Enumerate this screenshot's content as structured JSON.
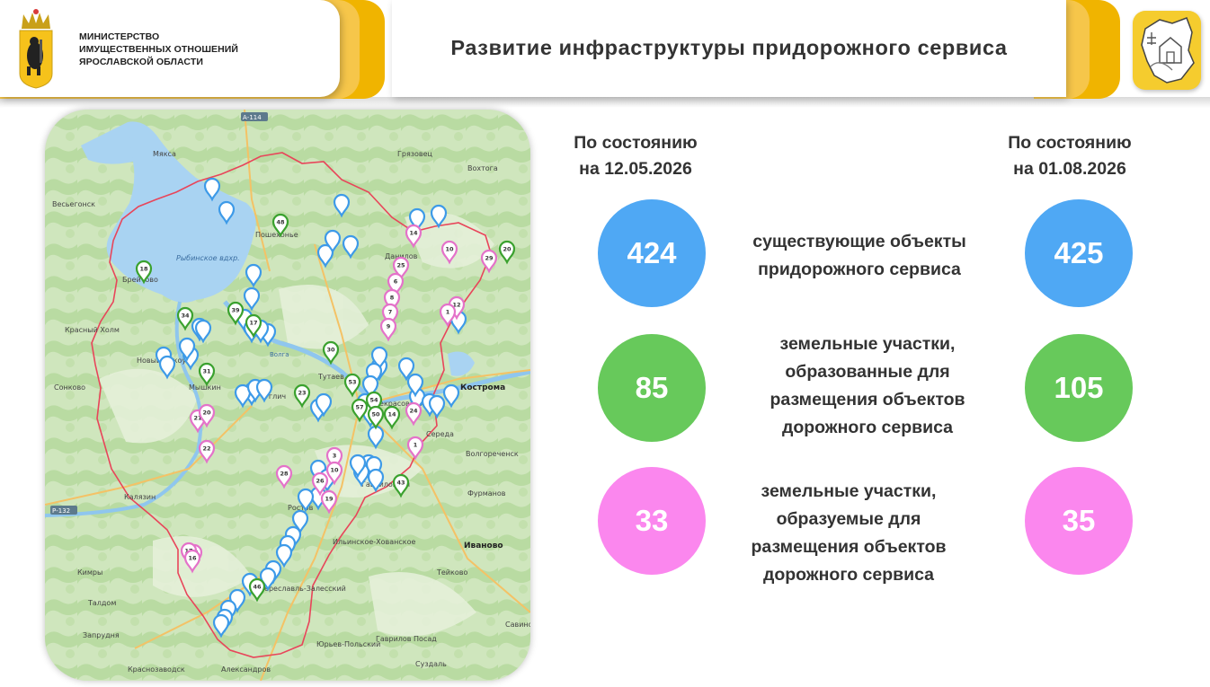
{
  "header": {
    "ministry_line1": "МИНИСТЕРСТВО",
    "ministry_line2": "ИМУЩЕСТВЕННЫХ ОТНОШЕНИЙ",
    "ministry_line3": "ЯРОСЛАВСКОЙ ОБЛАСТИ",
    "title": "Развитие инфраструктуры придорожного сервиса",
    "coat_of_arms_icon": "yaroslavl-bear-coat-icon",
    "right_logo_icon": "region-map-house-logo-icon"
  },
  "columns": {
    "left_line1": "По состоянию",
    "left_line2": "на 12.05.2026",
    "right_line1": "По состоянию",
    "right_line2": "на 01.08.2026"
  },
  "rows": [
    {
      "label_lines": [
        "существующие объекты",
        "придорожного сервиса"
      ],
      "value_before": "424",
      "value_after": "425",
      "color": "#4fa8f4"
    },
    {
      "label_lines": [
        "земельные участки,",
        "образованные для",
        "размещения объектов",
        "дорожного сервиса"
      ],
      "value_before": "85",
      "value_after": "105",
      "color": "#67c95b"
    },
    {
      "label_lines": [
        "земельные участки,",
        "образуемые для",
        "размещения объектов",
        "дорожного сервиса"
      ],
      "value_before": "33",
      "value_after": "35",
      "color": "#fb87ee"
    }
  ],
  "map": {
    "place_labels": [
      "Мякса",
      "Грязовец",
      "Вохтога",
      "Весьегонск",
      "Пошехонье",
      "Рыбинское вдхр.",
      "Брейтово",
      "Красный Холм",
      "Новый Некоуз",
      "Сонково",
      "Мышкин",
      "Тутаев",
      "Углич",
      "Кострома",
      "Некрасовское",
      "Середа",
      "Волгореченск",
      "Фурманов",
      "Калязин",
      "Гаврилов-Ям",
      "Ростов",
      "Иваново",
      "Кимры",
      "Талдом",
      "Тейково",
      "Запрудня",
      "Юрьев-Польский",
      "Гаврилов Посад",
      "Савино",
      "Суздаль",
      "Краснозаводск",
      "Александров",
      "Переславль-Залесский",
      "Ильинское-Хованское",
      "Данилов"
    ],
    "road_labels": [
      "А-114",
      "Р-132",
      "Волга"
    ],
    "legend_colors": {
      "existing": "#3d9ae8",
      "formed": "#3aa12e",
      "forming": "#e472c9",
      "border": "#e8455a",
      "water": "#a9d3f2"
    },
    "pin_numbers_green": [
      "48",
      "18",
      "34",
      "39",
      "17",
      "31",
      "30",
      "53",
      "57",
      "54",
      "50",
      "14",
      "43",
      "46",
      "23",
      "20"
    ],
    "pin_numbers_pink": [
      "14",
      "25",
      "6",
      "8",
      "7",
      "9",
      "10",
      "12",
      "1",
      "29",
      "21",
      "20",
      "22",
      "24",
      "1",
      "3",
      "10",
      "28",
      "26",
      "19",
      "18",
      "17",
      "16"
    ]
  }
}
